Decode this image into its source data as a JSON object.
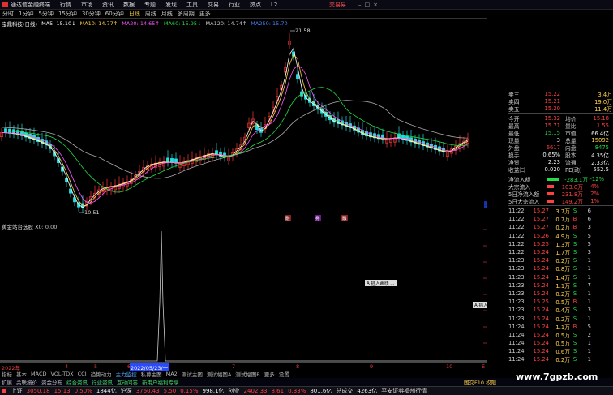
{
  "titlebar": {
    "app_name": "通达信金融终端",
    "menus": [
      "行情",
      "市场",
      "资讯",
      "数据",
      "专题",
      "发现",
      "工具",
      "交易",
      "行业",
      "热点",
      "L2"
    ],
    "active_menu_right": "交易易"
  },
  "periods": [
    "分时",
    "1分钟",
    "5分钟",
    "15分钟",
    "30分钟",
    "60分钟",
    "日线",
    "周线",
    "月线",
    "多周期",
    "更多"
  ],
  "active_period": "日线",
  "kline": {
    "stock_label": "宝鼎科技(日线)",
    "ma": [
      {
        "label": "MA5: 15.10↓",
        "color": "#ffffff"
      },
      {
        "label": "MA10: 14.77↑",
        "color": "#ffd24a"
      },
      {
        "label": "MA20: 14.65↑",
        "color": "#ff55ff"
      },
      {
        "label": "MA60: 15.95↓",
        "color": "#22dd44"
      },
      {
        "label": "MA120: 14.74↑",
        "color": "#cccccc"
      },
      {
        "label": "MA250: 15.70",
        "color": "#4488ff"
      }
    ],
    "high_label": "21.58",
    "low_label": "10.51",
    "yaxis": [
      "17.00",
      "16.00",
      "15.00",
      "14.00",
      "13.00",
      "12.00",
      "11.00"
    ],
    "price_box": "10.67",
    "markers": [
      "融",
      "券",
      "融"
    ]
  },
  "indicator": {
    "title": "黄金站台选股 X0: 0.00",
    "tooltip1": "A 插入画线 ...",
    "tooltip2": "A 插入画线 ..."
  },
  "xaxis": {
    "labels": [
      "2022年",
      "4",
      "5",
      "6",
      "2022/05/23/一",
      "7",
      "8",
      "9",
      "10",
      "E"
    ]
  },
  "tabs1": [
    "指标",
    "基本",
    "MACD",
    "VOL-TDX",
    "CCI",
    "趋势动力",
    "主力监控",
    "私募主图",
    "MA2",
    "测试主图",
    "测试幅图A",
    "测试幅图B",
    "更多",
    "设置"
  ],
  "tabs1_active": "主力监控",
  "tabs2": [
    "扩展",
    "关联报价",
    "资金分布",
    "综合资讯",
    "行业资讯",
    "互动问答",
    "新用户福利专享"
  ],
  "tabs2_right": "国交F10 权限",
  "statusbar": {
    "sh_label": "上证",
    "sh_val": "3050.18",
    "sh_chg": "15.13",
    "sh_pct": "0.50%",
    "sh_amt": "1844亿",
    "sz_label": "沪深",
    "sz_val": "3760.43",
    "sz_chg": "5.50",
    "sz_pct": "0.15%",
    "sz_amt": "998.1亿",
    "cy_label": "创业",
    "cy_val": "2402.33",
    "cy_chg": "8.61",
    "cy_pct": "0.33%",
    "cy_amt": "801.6亿",
    "total_label": "总成交",
    "total_val": "4263亿",
    "broker": "平安证券福州行情"
  },
  "quote": {
    "asks": [
      {
        "label": "卖三",
        "price": "15.22",
        "vol": "3.4万"
      },
      {
        "label": "卖四",
        "price": "15.21",
        "vol": "19.0万"
      },
      {
        "label": "卖五",
        "price": "15.20",
        "vol": "11.4万"
      }
    ],
    "fields": [
      {
        "l1": "今开",
        "v1": "15.32",
        "c1": "red",
        "l2": "均价",
        "v2": "15.18",
        "c2": "red"
      },
      {
        "l1": "最高",
        "v1": "15.71",
        "c1": "red",
        "l2": "量比",
        "v2": "1.55",
        "c2": "red"
      },
      {
        "l1": "最低",
        "v1": "15.15",
        "c1": "green",
        "l2": "市值",
        "v2": "66.4亿",
        "c2": "white"
      },
      {
        "l1": "现量",
        "v1": "3",
        "c1": "white",
        "l2": "总量",
        "v2": "15092",
        "c2": "yellow"
      },
      {
        "l1": "外盘",
        "v1": "6617",
        "c1": "red",
        "l2": "内盘",
        "v2": "8475",
        "c2": "green"
      },
      {
        "l1": "换手",
        "v1": "0.65%",
        "c1": "white",
        "l2": "股本",
        "v2": "4.35亿",
        "c2": "white"
      },
      {
        "l1": "净资",
        "v1": "2.23",
        "c1": "white",
        "l2": "流通",
        "v2": "2.33亿",
        "c2": "white"
      },
      {
        "l1": "收益㈡",
        "v1": "0.020",
        "c1": "white",
        "l2": "PE(动)",
        "v2": "552.5",
        "c2": "white"
      }
    ],
    "flows": [
      {
        "label": "净流入额",
        "val": "-283.1万",
        "pct": "-12%",
        "color": "green"
      },
      {
        "label": "大宗流入",
        "val": "103.0万",
        "pct": "4%",
        "color": "red"
      },
      {
        "label": "5日净流入额",
        "val": "231.8万",
        "pct": "2%",
        "color": "red"
      },
      {
        "label": "5日大宗流入",
        "val": "149.2万",
        "pct": "1%",
        "color": "red"
      }
    ]
  },
  "ticks": [
    {
      "t": "11:22",
      "p": "15.27",
      "v": "3.7万",
      "d": "S",
      "n": "6"
    },
    {
      "t": "11:22",
      "p": "15.27",
      "v": "0.7万",
      "d": "B",
      "n": "6"
    },
    {
      "t": "11:22",
      "p": "15.27",
      "v": "0.2万",
      "d": "B",
      "n": "3"
    },
    {
      "t": "11:22",
      "p": "15.26",
      "v": "4.9万",
      "d": "S",
      "n": "5"
    },
    {
      "t": "11:22",
      "p": "15.25",
      "v": "1.3万",
      "d": "S",
      "n": "5"
    },
    {
      "t": "11:22",
      "p": "15.24",
      "v": "1.7万",
      "d": "S",
      "n": "3"
    },
    {
      "t": "11:23",
      "p": "15.24",
      "v": "0.2万",
      "d": "S",
      "n": "1"
    },
    {
      "t": "11:23",
      "p": "15.24",
      "v": "0.8万",
      "d": "S",
      "n": "1"
    },
    {
      "t": "11:23",
      "p": "15.24",
      "v": "1.4万",
      "d": "S",
      "n": "1"
    },
    {
      "t": "11:23",
      "p": "15.24",
      "v": "1.1万",
      "d": "S",
      "n": "7"
    },
    {
      "t": "11:23",
      "p": "15.24",
      "v": "0.2万",
      "d": "S",
      "n": "1"
    },
    {
      "t": "11:23",
      "p": "15.25",
      "v": "0.5万",
      "d": "B",
      "n": "1"
    },
    {
      "t": "11:23",
      "p": "15.24",
      "v": "0.4万",
      "d": "S",
      "n": "3"
    },
    {
      "t": "11:23",
      "p": "15.24",
      "v": "0.2万",
      "d": "S",
      "n": "1"
    },
    {
      "t": "11:24",
      "p": "15.24",
      "v": "1.1万",
      "d": "B",
      "n": "5"
    },
    {
      "t": "11:24",
      "p": "15.24",
      "v": "0.5万",
      "d": "S",
      "n": "2"
    },
    {
      "t": "11:24",
      "p": "15.24",
      "v": "0.5万",
      "d": "S",
      "n": "1"
    },
    {
      "t": "11:24",
      "p": "15.24",
      "v": "0.6万",
      "d": "S",
      "n": "1"
    },
    {
      "t": "11:24",
      "p": "15.24",
      "v": "0.2万",
      "d": "S",
      "n": "1"
    }
  ],
  "watermark": "www.7gpzb.com"
}
